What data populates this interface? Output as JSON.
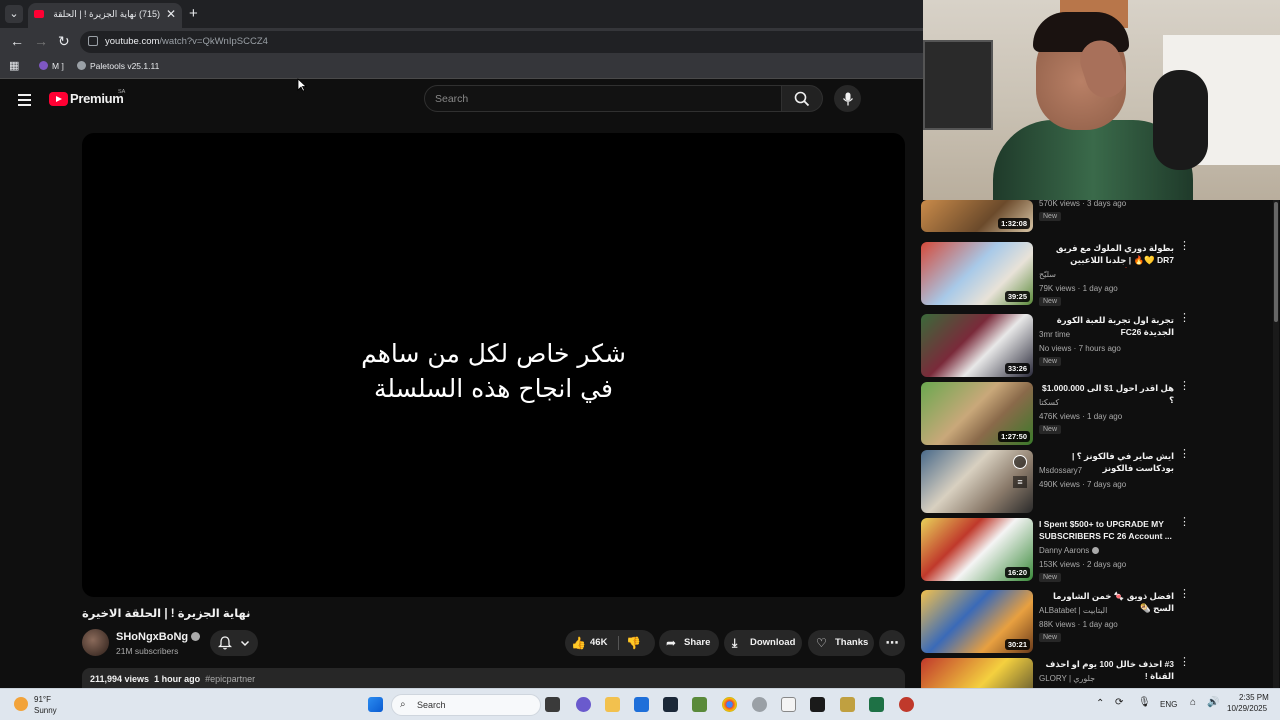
{
  "browser": {
    "tab_title": "(715) نهاية الجزيرة ! | الحلقة الاخيرة",
    "url_host": "youtube.com",
    "url_path": "/watch?v=QkWnIpSCCZ4",
    "bookmarks": [
      "M ]",
      "Paletools v25.1.11"
    ]
  },
  "youtube": {
    "brand": "Premium",
    "country": "SA",
    "search_placeholder": "Search"
  },
  "video": {
    "overlay_line1": "شكر خاص لكل من ساهم",
    "overlay_line2": "في انجاح هذه السلسلة",
    "title": "نهاية الجزيرة ! | الحلقة الاخيرة",
    "channel": "SHoNgxBoNg",
    "subscribers": "21M subscribers",
    "likes": "46K",
    "share_label": "Share",
    "download_label": "Download",
    "thanks_label": "Thanks",
    "views": "211,994 views",
    "age": "1 hour ago",
    "tag": "#epicpartner"
  },
  "recommendations": [
    {
      "title": "",
      "channel": "",
      "meta": "570K views · 3 days ago",
      "badge": "New",
      "duration": "1:32:08",
      "rtl": false
    },
    {
      "title": "بطولة دوري الملوك مع فريق DR7 💛🔥 | جلدنا اللاعبين قالباص 😂🔥",
      "channel": "سليّح",
      "meta": "79K views · 1 day ago",
      "badge": "New",
      "duration": "39:25",
      "rtl": true
    },
    {
      "title": "تجربة اول تجربة للعبة الكورة الجديدة FC26",
      "channel": "3mr time",
      "meta": "No views · 7 hours ago",
      "badge": "New",
      "duration": "33:26",
      "rtl": true
    },
    {
      "title": "هل اقدر احول 1$ الى 1.000.000$ ؟",
      "channel": "كسكتا",
      "meta": "476K views · 1 day ago",
      "badge": "New",
      "duration": "1:27:50",
      "rtl": true
    },
    {
      "title": "ايش صاير في فالكونز ؟ | بودكاست فالكونز",
      "channel": "Msdossary7",
      "meta": "490K views · 7 days ago",
      "badge": "",
      "duration": "",
      "rtl": true
    },
    {
      "title": "I Spent $500+ to UPGRADE MY SUBSCRIBERS FC 26 Account ...",
      "channel": "Danny Aarons",
      "meta": "153K views · 2 days ago",
      "badge": "New",
      "duration": "16:20",
      "rtl": false
    },
    {
      "title": "افضل ذويق 🍬 خمن الشاورما السح 🌯",
      "channel": "ALBatabet | البتابيت",
      "meta": "88K views · 1 day ago",
      "badge": "New",
      "duration": "30:21",
      "rtl": true
    },
    {
      "title": "#3 احذف خالل 100 يوم او احذف القناة !",
      "channel": "GLORY | جلوري",
      "meta": "",
      "badge": "",
      "duration": "",
      "rtl": true
    }
  ],
  "taskbar": {
    "temp": "91°F",
    "condition": "Sunny",
    "search_label": "Search",
    "lang": "ENG",
    "time": "2:35 PM",
    "date": "10/29/2025"
  },
  "colors": {
    "youtube_red": "#ff0033",
    "background": "#0f0f0f",
    "chip": "#272727"
  }
}
